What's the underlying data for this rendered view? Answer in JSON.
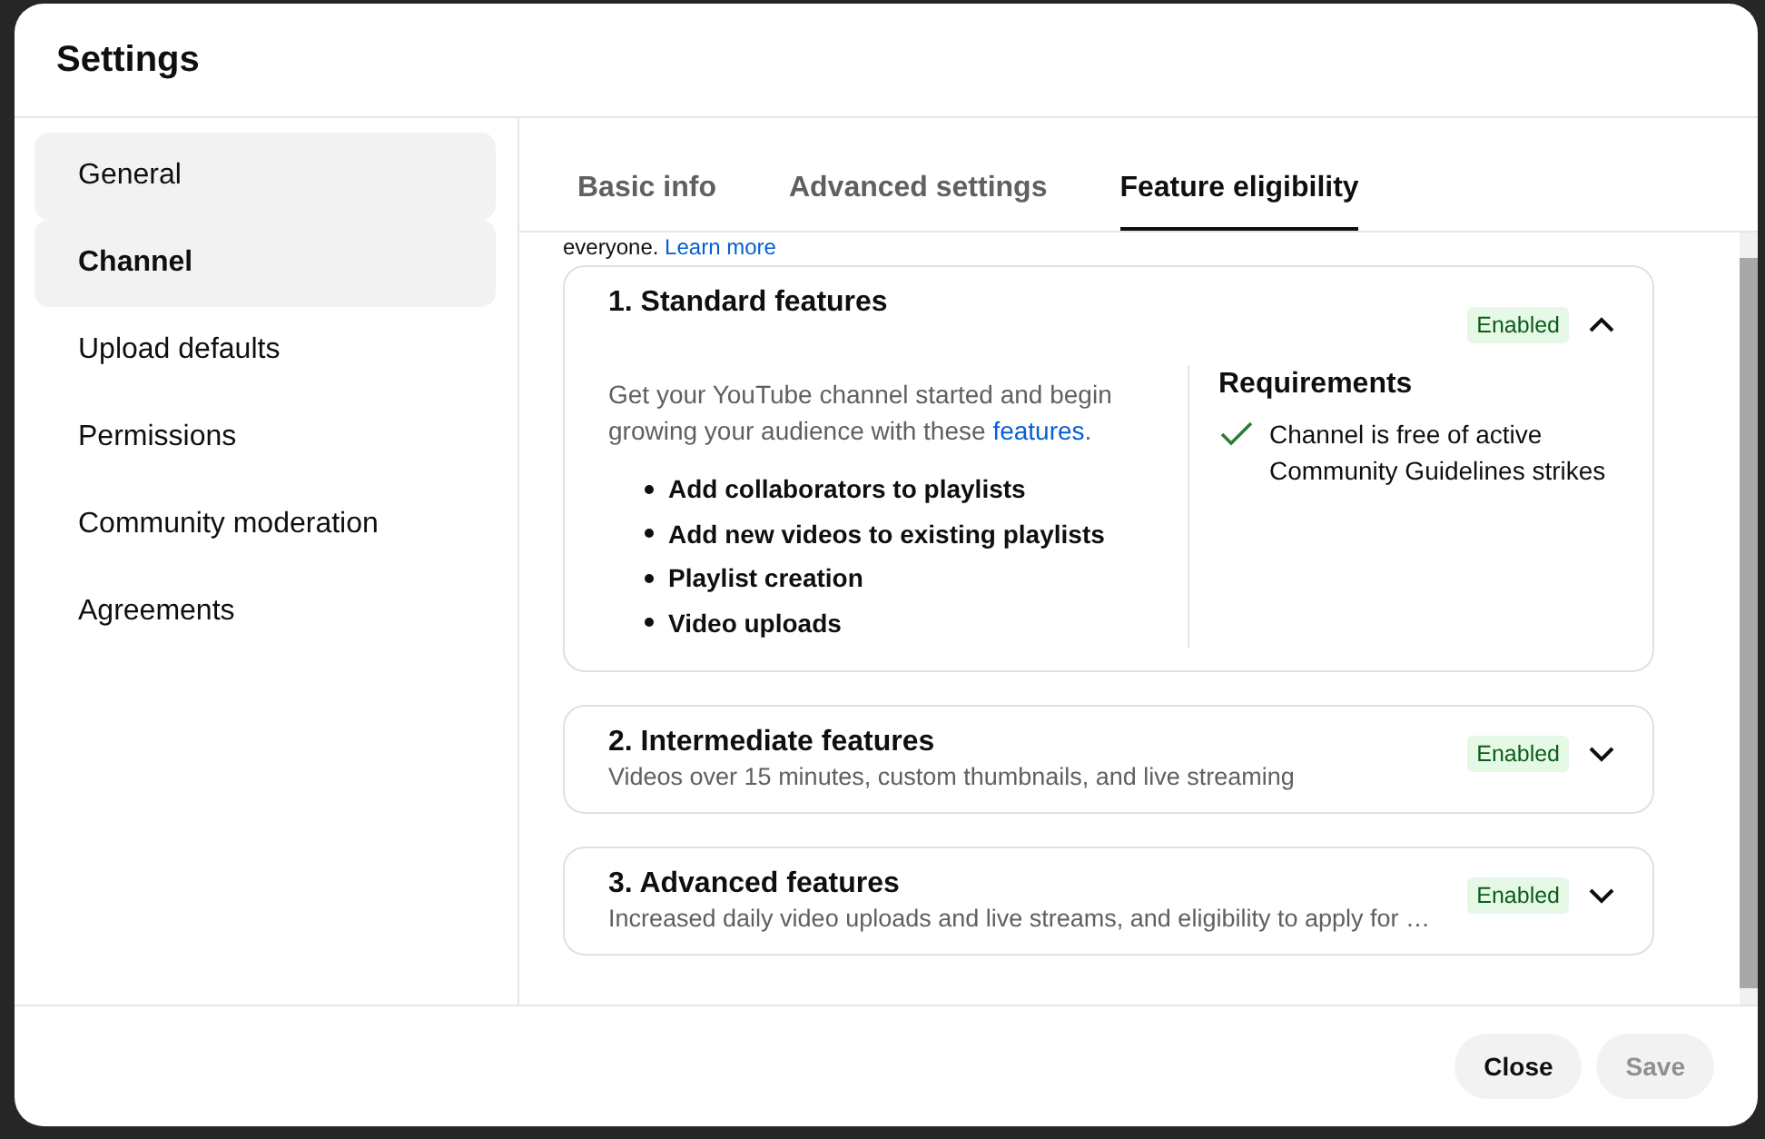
{
  "dialog": {
    "title": "Settings"
  },
  "sidebar": {
    "items": [
      {
        "label": "General",
        "selected": false,
        "hovered": true
      },
      {
        "label": "Channel",
        "selected": true,
        "hovered": false
      },
      {
        "label": "Upload defaults",
        "selected": false,
        "hovered": false
      },
      {
        "label": "Permissions",
        "selected": false,
        "hovered": false
      },
      {
        "label": "Community moderation",
        "selected": false,
        "hovered": false
      },
      {
        "label": "Agreements",
        "selected": false,
        "hovered": false
      }
    ]
  },
  "tabs": [
    {
      "label": "Basic info",
      "selected": false
    },
    {
      "label": "Advanced settings",
      "selected": false
    },
    {
      "label": "Feature eligibility",
      "selected": true
    }
  ],
  "intro_fragment": {
    "text": "everyone.",
    "link": "Learn more"
  },
  "features": [
    {
      "title": "1. Standard features",
      "status": "Enabled",
      "expanded": true,
      "description": {
        "before": "Get your YouTube channel started and begin growing your audience with these ",
        "link": "features",
        "after": "."
      },
      "benefits": [
        "Add collaborators to playlists",
        "Add new videos to existing playlists",
        "Playlist creation",
        "Video uploads"
      ],
      "requirements": {
        "title": "Requirements",
        "items": [
          {
            "text": "Channel is free of active Community Guidelines strikes",
            "met": true
          }
        ]
      }
    },
    {
      "title": "2. Intermediate features",
      "status": "Enabled",
      "expanded": false,
      "summary": "Videos over 15 minutes, custom thumbnails, and live streaming"
    },
    {
      "title": "3. Advanced features",
      "status": "Enabled",
      "expanded": false,
      "summary": "Increased daily video uploads and live streams, and eligibility to apply for …"
    }
  ],
  "footer": {
    "buttons": [
      {
        "label": "Close",
        "disabled": false
      },
      {
        "label": "Save",
        "disabled": true
      }
    ]
  }
}
